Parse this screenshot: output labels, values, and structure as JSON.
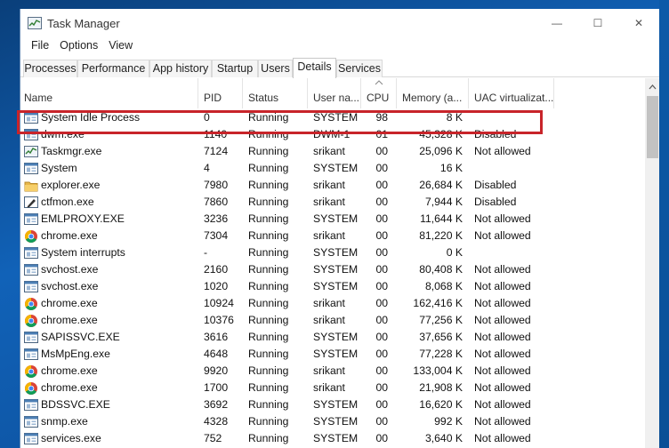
{
  "window": {
    "title": "Task Manager",
    "controls": {
      "minimize": "—",
      "maximize": "☐",
      "close": "✕"
    }
  },
  "menu": [
    "File",
    "Options",
    "View"
  ],
  "tabs": [
    "Processes",
    "Performance",
    "App history",
    "Startup",
    "Users",
    "Details",
    "Services"
  ],
  "active_tab": "Details",
  "columns": [
    "Name",
    "PID",
    "Status",
    "User na...",
    "CPU",
    "Memory (a...",
    "UAC virtualizat..."
  ],
  "sort_column": "CPU",
  "highlight_color": "#c8242a",
  "rows": [
    {
      "name": "System Idle Process",
      "icon": "window-icon",
      "pid": "0",
      "status": "Running",
      "user": "SYSTEM",
      "cpu": "98",
      "mem": "8 K",
      "uac": ""
    },
    {
      "name": "dwm.exe",
      "icon": "window-icon",
      "pid": "1140",
      "status": "Running",
      "user": "DWM-1",
      "cpu": "01",
      "mem": "45,328 K",
      "uac": "Disabled"
    },
    {
      "name": "Taskmgr.exe",
      "icon": "taskmgr-icon",
      "pid": "7124",
      "status": "Running",
      "user": "srikant",
      "cpu": "00",
      "mem": "25,096 K",
      "uac": "Not allowed"
    },
    {
      "name": "System",
      "icon": "window-icon",
      "pid": "4",
      "status": "Running",
      "user": "SYSTEM",
      "cpu": "00",
      "mem": "16 K",
      "uac": ""
    },
    {
      "name": "explorer.exe",
      "icon": "folder-icon",
      "pid": "7980",
      "status": "Running",
      "user": "srikant",
      "cpu": "00",
      "mem": "26,684 K",
      "uac": "Disabled"
    },
    {
      "name": "ctfmon.exe",
      "icon": "ctfmon-icon",
      "pid": "7860",
      "status": "Running",
      "user": "srikant",
      "cpu": "00",
      "mem": "7,944 K",
      "uac": "Disabled"
    },
    {
      "name": "EMLPROXY.EXE",
      "icon": "window-icon",
      "pid": "3236",
      "status": "Running",
      "user": "SYSTEM",
      "cpu": "00",
      "mem": "11,644 K",
      "uac": "Not allowed"
    },
    {
      "name": "chrome.exe",
      "icon": "chrome-icon",
      "pid": "7304",
      "status": "Running",
      "user": "srikant",
      "cpu": "00",
      "mem": "81,220 K",
      "uac": "Not allowed"
    },
    {
      "name": "System interrupts",
      "icon": "window-icon",
      "pid": "-",
      "status": "Running",
      "user": "SYSTEM",
      "cpu": "00",
      "mem": "0 K",
      "uac": ""
    },
    {
      "name": "svchost.exe",
      "icon": "window-icon",
      "pid": "2160",
      "status": "Running",
      "user": "SYSTEM",
      "cpu": "00",
      "mem": "80,408 K",
      "uac": "Not allowed"
    },
    {
      "name": "svchost.exe",
      "icon": "window-icon",
      "pid": "1020",
      "status": "Running",
      "user": "SYSTEM",
      "cpu": "00",
      "mem": "8,068 K",
      "uac": "Not allowed"
    },
    {
      "name": "chrome.exe",
      "icon": "chrome-icon",
      "pid": "10924",
      "status": "Running",
      "user": "srikant",
      "cpu": "00",
      "mem": "162,416 K",
      "uac": "Not allowed"
    },
    {
      "name": "chrome.exe",
      "icon": "chrome-icon",
      "pid": "10376",
      "status": "Running",
      "user": "srikant",
      "cpu": "00",
      "mem": "77,256 K",
      "uac": "Not allowed"
    },
    {
      "name": "SAPISSVC.EXE",
      "icon": "window-icon",
      "pid": "3616",
      "status": "Running",
      "user": "SYSTEM",
      "cpu": "00",
      "mem": "37,656 K",
      "uac": "Not allowed"
    },
    {
      "name": "MsMpEng.exe",
      "icon": "window-icon",
      "pid": "4648",
      "status": "Running",
      "user": "SYSTEM",
      "cpu": "00",
      "mem": "77,228 K",
      "uac": "Not allowed"
    },
    {
      "name": "chrome.exe",
      "icon": "chrome-icon",
      "pid": "9920",
      "status": "Running",
      "user": "srikant",
      "cpu": "00",
      "mem": "133,004 K",
      "uac": "Not allowed"
    },
    {
      "name": "chrome.exe",
      "icon": "chrome-icon",
      "pid": "1700",
      "status": "Running",
      "user": "srikant",
      "cpu": "00",
      "mem": "21,908 K",
      "uac": "Not allowed"
    },
    {
      "name": "BDSSVC.EXE",
      "icon": "window-icon",
      "pid": "3692",
      "status": "Running",
      "user": "SYSTEM",
      "cpu": "00",
      "mem": "16,620 K",
      "uac": "Not allowed"
    },
    {
      "name": "snmp.exe",
      "icon": "window-icon",
      "pid": "4328",
      "status": "Running",
      "user": "SYSTEM",
      "cpu": "00",
      "mem": "992 K",
      "uac": "Not allowed"
    },
    {
      "name": "services.exe",
      "icon": "window-icon",
      "pid": "752",
      "status": "Running",
      "user": "SYSTEM",
      "cpu": "00",
      "mem": "3,640 K",
      "uac": "Not allowed"
    }
  ]
}
